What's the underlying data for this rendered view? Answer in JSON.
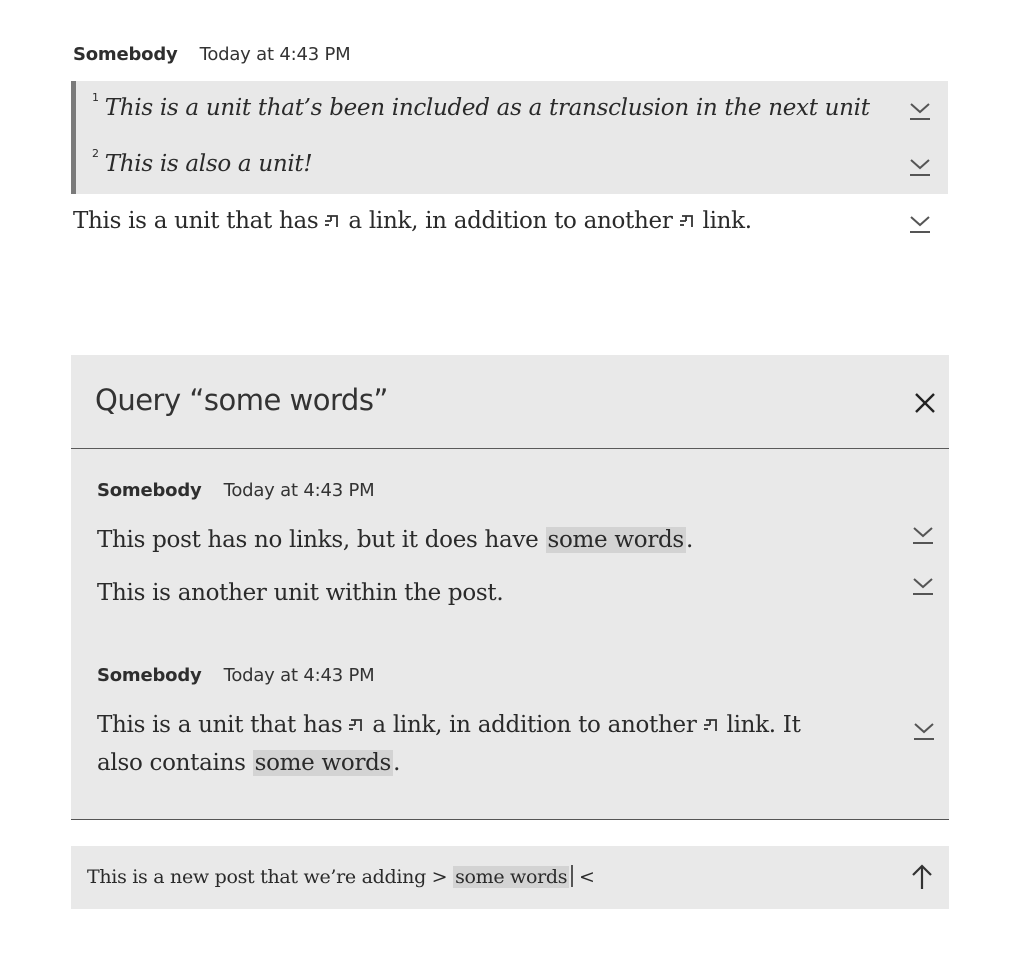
{
  "top_post": {
    "author": "Somebody",
    "time": "Today at 4:43 PM",
    "transclusions": [
      {
        "num": "1",
        "text": "This is a unit that’s been included as a transclusion in the next unit",
        "icon": "download-icon"
      },
      {
        "num": "2",
        "text": "This is also a unit!",
        "icon": "download-icon"
      }
    ],
    "unit": {
      "part1": "This is a unit that has",
      "part2": "a link, in addition to another",
      "part3": "link.",
      "icon": "link-icon"
    }
  },
  "query": {
    "title": "Query “some words”",
    "close_icon": "close-icon",
    "results": [
      {
        "author": "Somebody",
        "time": "Today at 4:43 PM",
        "unit1": {
          "before": "This post has no links, but it does have",
          "highlight": "some words",
          "after": "."
        },
        "unit2": "This is another unit within the post."
      },
      {
        "author": "Somebody",
        "time": "Today at 4:43 PM",
        "line1": {
          "part1": "This is a unit that has",
          "part2": "a link, in addition to another",
          "part3": "link. It"
        },
        "line2": {
          "before": "also contains",
          "highlight": "some words",
          "after": "."
        }
      }
    ]
  },
  "composer": {
    "before": "This is a new post that we’re adding >",
    "highlight": "some words",
    "after": "<",
    "submit_icon": "arrow-up-icon"
  },
  "colors": {
    "panel_bg": "#e9e9e9",
    "highlight_bg": "#d3d3d3",
    "quote_bar": "#7a7a7a"
  }
}
